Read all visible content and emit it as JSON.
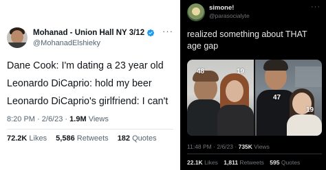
{
  "left_tweet": {
    "display_name": "Mohanad - Union Hall NY 3/12",
    "handle": "@MohanadElshieky",
    "more": "···",
    "lines": [
      "Dane Cook: I'm dating a 23 year old",
      "Leonardo DiCaprio: hold my beer",
      "Leonardo DiCaprio's girlfriend: I can't"
    ],
    "time": "8:20 PM",
    "separator": "·",
    "date": "2/6/23",
    "views_count": "1.9M",
    "views_label": "Views",
    "likes_count": "72.2K",
    "likes_label": "Likes",
    "retweets_count": "5,586",
    "retweets_label": "Retweets",
    "quotes_count": "182",
    "quotes_label": "Quotes",
    "colors": {
      "verified": "#1d9bf0",
      "text": "#0f1419",
      "muted": "#536471"
    }
  },
  "right_tweet": {
    "display_name": "simone!",
    "handle": "@parasocialyte",
    "more": "···",
    "text": "realized something about THAT age gap",
    "media": {
      "image1": {
        "badge_a": "48",
        "badge_b": "19"
      },
      "image2": {
        "badge_a": "47",
        "badge_b": "19"
      }
    },
    "time": "11:48 PM",
    "separator": "·",
    "date": "2/6/23",
    "views_count": "735K",
    "views_label": "Views",
    "likes_count": "22.1K",
    "likes_label": "Likes",
    "retweets_count": "1,811",
    "retweets_label": "Retweets",
    "quotes_count": "595",
    "quotes_label": "Quotes",
    "colors": {
      "background": "#000000",
      "text": "#e7e9ea",
      "muted": "#71767b"
    }
  }
}
